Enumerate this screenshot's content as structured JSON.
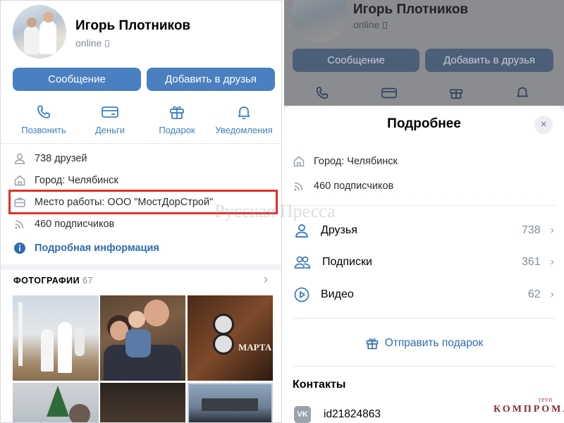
{
  "left": {
    "profile": {
      "name": "Игорь Плотников",
      "status": "online"
    },
    "buttons": {
      "message": "Сообщение",
      "add_friend": "Добавить в друзья"
    },
    "actions": [
      {
        "label": "Позвонить",
        "icon": "phone-icon"
      },
      {
        "label": "Деньги",
        "icon": "money-icon"
      },
      {
        "label": "Подарок",
        "icon": "gift-icon"
      },
      {
        "label": "Уведомления",
        "icon": "bell-icon"
      }
    ],
    "info": {
      "friends": "738 друзей",
      "city": "Город: Челябинск",
      "work": "Место работы: ООО \"МостДорСтрой\"",
      "followers": "460 подписчиков",
      "details_link": "Подробная информация"
    },
    "photos": {
      "label": "ФОТОГРАФИИ",
      "count": "67",
      "overlay_text": "МАРТА"
    }
  },
  "right": {
    "dimmed": {
      "name": "Игорь Плотников",
      "status": "online",
      "message": "Сообщение",
      "add_friend": "Добавить в друзья"
    },
    "sheet": {
      "title": "Подробнее",
      "close": "×",
      "city": "Город: Челябинск",
      "followers": "460 подписчиков",
      "items": [
        {
          "label": "Друзья",
          "value": "738",
          "icon": "friends-icon"
        },
        {
          "label": "Подписки",
          "value": "361",
          "icon": "subscriptions-icon"
        },
        {
          "label": "Видео",
          "value": "62",
          "icon": "video-icon"
        }
      ],
      "send_gift": "Отправить подарок",
      "contacts_title": "Контакты",
      "vk_id": "id21824863",
      "vk_badge": "VK"
    }
  },
  "watermarks": {
    "press": "Русская Пресса",
    "kompromat": "КОМПРОМАТ",
    "group": "ГРУП"
  },
  "colors": {
    "accent": "#4a7fc1",
    "link": "#2d6cb4",
    "highlight": "#e0322a"
  }
}
